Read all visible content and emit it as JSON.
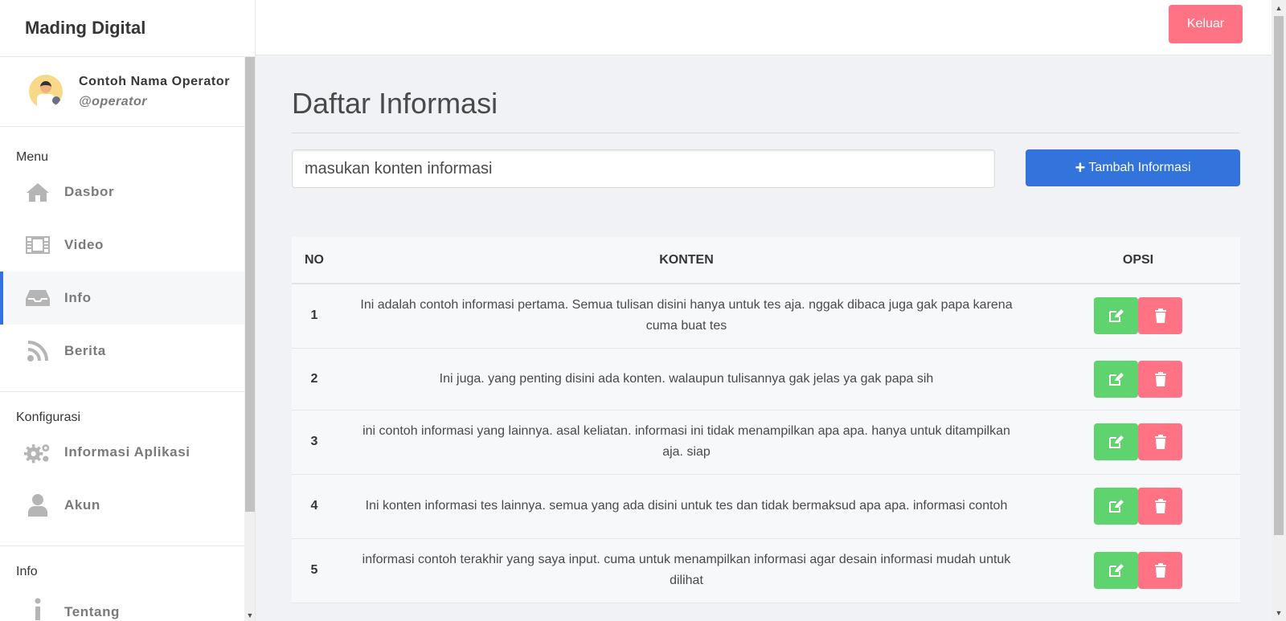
{
  "brand": "Mading Digital",
  "user": {
    "name": "Contoh Nama Operator",
    "handle": "@operator"
  },
  "sidebar": {
    "sections": [
      {
        "label": "Menu",
        "items": [
          {
            "label": "Dasbor",
            "icon": "home-icon"
          },
          {
            "label": "Video",
            "icon": "film-icon"
          },
          {
            "label": "Info",
            "icon": "inbox-icon",
            "active": true
          },
          {
            "label": "Berita",
            "icon": "rss-icon"
          }
        ]
      },
      {
        "label": "Konfigurasi",
        "items": [
          {
            "label": "Informasi Aplikasi",
            "icon": "gears-icon"
          },
          {
            "label": "Akun",
            "icon": "user-icon"
          }
        ]
      },
      {
        "label": "Info",
        "items": [
          {
            "label": "Tentang",
            "icon": "info-icon"
          }
        ]
      }
    ]
  },
  "topbar": {
    "logout_label": "Keluar"
  },
  "main": {
    "title": "Daftar Informasi",
    "input_placeholder": "masukan konten informasi",
    "add_button_label": "Tambah Informasi",
    "table": {
      "headers": {
        "no": "NO",
        "content": "KONTEN",
        "options": "OPSI"
      },
      "rows": [
        {
          "no": "1",
          "content": "Ini adalah contoh informasi pertama. Semua tulisan disini hanya untuk tes aja. nggak dibaca juga gak papa karena cuma buat tes"
        },
        {
          "no": "2",
          "content": "Ini juga. yang penting disini ada konten. walaupun tulisannya gak jelas ya gak papa sih"
        },
        {
          "no": "3",
          "content": "ini contoh informasi yang lainnya. asal keliatan. informasi ini tidak menampilkan apa apa. hanya untuk ditampilkan aja. siap"
        },
        {
          "no": "4",
          "content": "Ini konten informasi tes lainnya. semua yang ada disini untuk tes dan tidak bermaksud apa apa. informasi contoh"
        },
        {
          "no": "5",
          "content": "informasi contoh terakhir yang saya input. cuma untuk menampilkan informasi agar desain informasi mudah untuk dilihat"
        }
      ]
    }
  },
  "colors": {
    "primary": "#3273dc",
    "success": "#5fd36e",
    "danger": "#ff7385"
  }
}
